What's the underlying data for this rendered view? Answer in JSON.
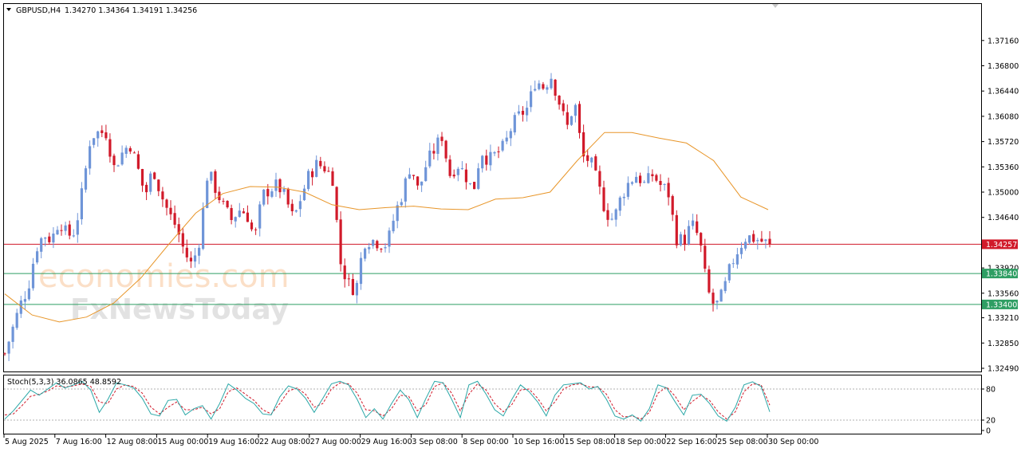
{
  "chart_data": {
    "type": "candlestick",
    "symbol_header": "GBPUSD,H4",
    "ohlc_header": "1.34270 1.34364 1.34191 1.34256",
    "colors": {
      "bull": "#6f95d8",
      "bear": "#d11a2a",
      "ma": "#e8962a",
      "price_line": "#d11a2a",
      "level": "#2e9e63",
      "stoch_main": "#2aa7a7",
      "stoch_signal": "#d11a2a",
      "grid_frame": "#000000"
    },
    "price_axis": {
      "ylim": [
        1.3249,
        1.3751
      ],
      "ticks": [
        "1.37160",
        "1.36800",
        "1.36440",
        "1.36080",
        "1.35720",
        "1.35360",
        "1.35000",
        "1.34640",
        "1.33920",
        "1.33560",
        "1.33210",
        "1.32850",
        "1.32490"
      ]
    },
    "time_axis": {
      "labels": [
        "5 Aug 2025",
        "7 Aug 16:00",
        "12 Aug 08:00",
        "15 Aug 00:00",
        "19 Aug 16:00",
        "22 Aug 08:00",
        "27 Aug 00:00",
        "29 Aug 16:00",
        "3 Sep 08:00",
        "8 Sep 00:00",
        "10 Sep 16:00",
        "15 Sep 08:00",
        "18 Sep 00:00",
        "22 Sep 16:00",
        "25 Sep 08:00",
        "30 Sep 00:00"
      ]
    },
    "price_series": [
      {
        "value": 1.327
      },
      {
        "value": 1.3305
      },
      {
        "value": 1.334
      },
      {
        "value": 1.3365
      },
      {
        "value": 1.342
      },
      {
        "value": 1.344
      },
      {
        "value": 1.3432
      },
      {
        "value": 1.3462
      },
      {
        "value": 1.3437
      },
      {
        "value": 1.3445
      },
      {
        "value": 1.3505
      },
      {
        "value": 1.358
      },
      {
        "value": 1.3585
      },
      {
        "value": 1.3585
      },
      {
        "value": 1.3535
      },
      {
        "value": 1.3555
      },
      {
        "value": 1.357
      },
      {
        "value": 1.3535
      },
      {
        "value": 1.3495
      },
      {
        "value": 1.3535
      },
      {
        "value": 1.3497
      },
      {
        "value": 1.347
      },
      {
        "value": 1.345
      },
      {
        "value": 1.3415
      },
      {
        "value": 1.3395
      },
      {
        "value": 1.3435
      },
      {
        "value": 1.353
      },
      {
        "value": 1.3505
      },
      {
        "value": 1.348
      },
      {
        "value": 1.346
      },
      {
        "value": 1.3475
      },
      {
        "value": 1.347
      },
      {
        "value": 1.3432
      },
      {
        "value": 1.3495
      },
      {
        "value": 1.3505
      },
      {
        "value": 1.351
      },
      {
        "value": 1.349
      },
      {
        "value": 1.346
      },
      {
        "value": 1.3495
      },
      {
        "value": 1.3525
      },
      {
        "value": 1.354
      },
      {
        "value": 1.3535
      },
      {
        "value": 1.352
      },
      {
        "value": 1.34
      },
      {
        "value": 1.337
      },
      {
        "value": 1.336
      },
      {
        "value": 1.343
      },
      {
        "value": 1.3432
      },
      {
        "value": 1.3428
      },
      {
        "value": 1.3425
      },
      {
        "value": 1.347
      },
      {
        "value": 1.35
      },
      {
        "value": 1.354
      },
      {
        "value": 1.35
      },
      {
        "value": 1.354
      },
      {
        "value": 1.356
      },
      {
        "value": 1.358
      },
      {
        "value": 1.3525
      },
      {
        "value": 1.354
      },
      {
        "value": 1.3525
      },
      {
        "value": 1.35
      },
      {
        "value": 1.356
      },
      {
        "value": 1.3545
      },
      {
        "value": 1.3555
      },
      {
        "value": 1.3565
      },
      {
        "value": 1.3595
      },
      {
        "value": 1.361
      },
      {
        "value": 1.362
      },
      {
        "value": 1.366
      },
      {
        "value": 1.365
      },
      {
        "value": 1.3665
      },
      {
        "value": 1.363
      },
      {
        "value": 1.359
      },
      {
        "value": 1.363
      },
      {
        "value": 1.355
      },
      {
        "value": 1.3545
      },
      {
        "value": 1.351
      },
      {
        "value": 1.3472
      },
      {
        "value": 1.346
      },
      {
        "value": 1.3495
      },
      {
        "value": 1.3515
      },
      {
        "value": 1.3525
      },
      {
        "value": 1.351
      },
      {
        "value": 1.3525
      },
      {
        "value": 1.351
      },
      {
        "value": 1.35
      },
      {
        "value": 1.3435
      },
      {
        "value": 1.343
      },
      {
        "value": 1.3455
      },
      {
        "value": 1.3433
      },
      {
        "value": 1.336
      },
      {
        "value": 1.3335
      },
      {
        "value": 1.3355
      },
      {
        "value": 1.3395
      },
      {
        "value": 1.342
      },
      {
        "value": 1.3437
      },
      {
        "value": 1.3434
      },
      {
        "value": 1.343
      },
      {
        "value": 1.34256
      }
    ],
    "moving_average": [
      {
        "value": 1.3355
      },
      {
        "value": 1.3325
      },
      {
        "value": 1.3315
      },
      {
        "value": 1.3322
      },
      {
        "value": 1.3342
      },
      {
        "value": 1.3378
      },
      {
        "value": 1.3425
      },
      {
        "value": 1.347
      },
      {
        "value": 1.3498
      },
      {
        "value": 1.3508
      },
      {
        "value": 1.3507
      },
      {
        "value": 1.35
      },
      {
        "value": 1.3482
      },
      {
        "value": 1.3475
      },
      {
        "value": 1.3478
      },
      {
        "value": 1.348
      },
      {
        "value": 1.3476
      },
      {
        "value": 1.3475
      },
      {
        "value": 1.349
      },
      {
        "value": 1.3492
      },
      {
        "value": 1.35
      },
      {
        "value": 1.3545
      },
      {
        "value": 1.3585
      },
      {
        "value": 1.3585
      },
      {
        "value": 1.3577
      },
      {
        "value": 1.357
      },
      {
        "value": 1.3545
      },
      {
        "value": 1.3493
      },
      {
        "value": 1.3475
      }
    ],
    "horizontal_levels": [
      {
        "value": 1.34257,
        "label": "1.34257",
        "kind": "current-price"
      },
      {
        "value": 1.3384,
        "label": "1.33840",
        "kind": "level"
      },
      {
        "value": 1.334,
        "label": "1.33400",
        "kind": "level"
      }
    ],
    "stochastic": {
      "header": "Stoch(5,3,3) 36.0865 48.8592",
      "ylim": [
        0,
        100
      ],
      "ticks": [
        "80",
        "20",
        "0"
      ],
      "levels": [
        80,
        20
      ],
      "main": [
        22,
        38,
        58,
        78,
        68,
        80,
        92,
        82,
        88,
        95,
        78,
        35,
        60,
        92,
        88,
        82,
        62,
        32,
        28,
        58,
        60,
        30,
        42,
        48,
        22,
        52,
        90,
        78,
        62,
        52,
        32,
        30,
        65,
        86,
        80,
        62,
        35,
        62,
        90,
        95,
        88,
        60,
        25,
        42,
        22,
        52,
        78,
        60,
        25,
        62,
        95,
        92,
        60,
        25,
        88,
        95,
        70,
        40,
        28,
        60,
        88,
        75,
        55,
        28,
        68,
        88,
        90,
        92,
        80,
        85,
        60,
        28,
        22,
        30,
        18,
        42,
        88,
        82,
        55,
        30,
        68,
        70,
        52,
        28,
        18,
        45,
        88,
        94,
        85,
        36
      ],
      "signal": [
        30,
        32,
        48,
        66,
        70,
        76,
        86,
        84,
        86,
        90,
        85,
        55,
        52,
        80,
        88,
        85,
        72,
        45,
        32,
        45,
        55,
        40,
        40,
        45,
        32,
        42,
        75,
        82,
        70,
        58,
        40,
        32,
        52,
        76,
        82,
        70,
        45,
        52,
        80,
        92,
        90,
        72,
        40,
        38,
        28,
        42,
        68,
        66,
        38,
        50,
        85,
        92,
        72,
        38,
        70,
        90,
        78,
        52,
        36,
        50,
        78,
        80,
        62,
        38,
        55,
        80,
        88,
        90,
        84,
        84,
        70,
        40,
        26,
        28,
        22,
        35,
        72,
        84,
        66,
        40,
        56,
        68,
        58,
        36,
        22,
        36,
        75,
        90,
        88,
        48.86
      ]
    }
  },
  "watermark": {
    "line1": "economies.com",
    "line2": "FxNewsToday"
  }
}
